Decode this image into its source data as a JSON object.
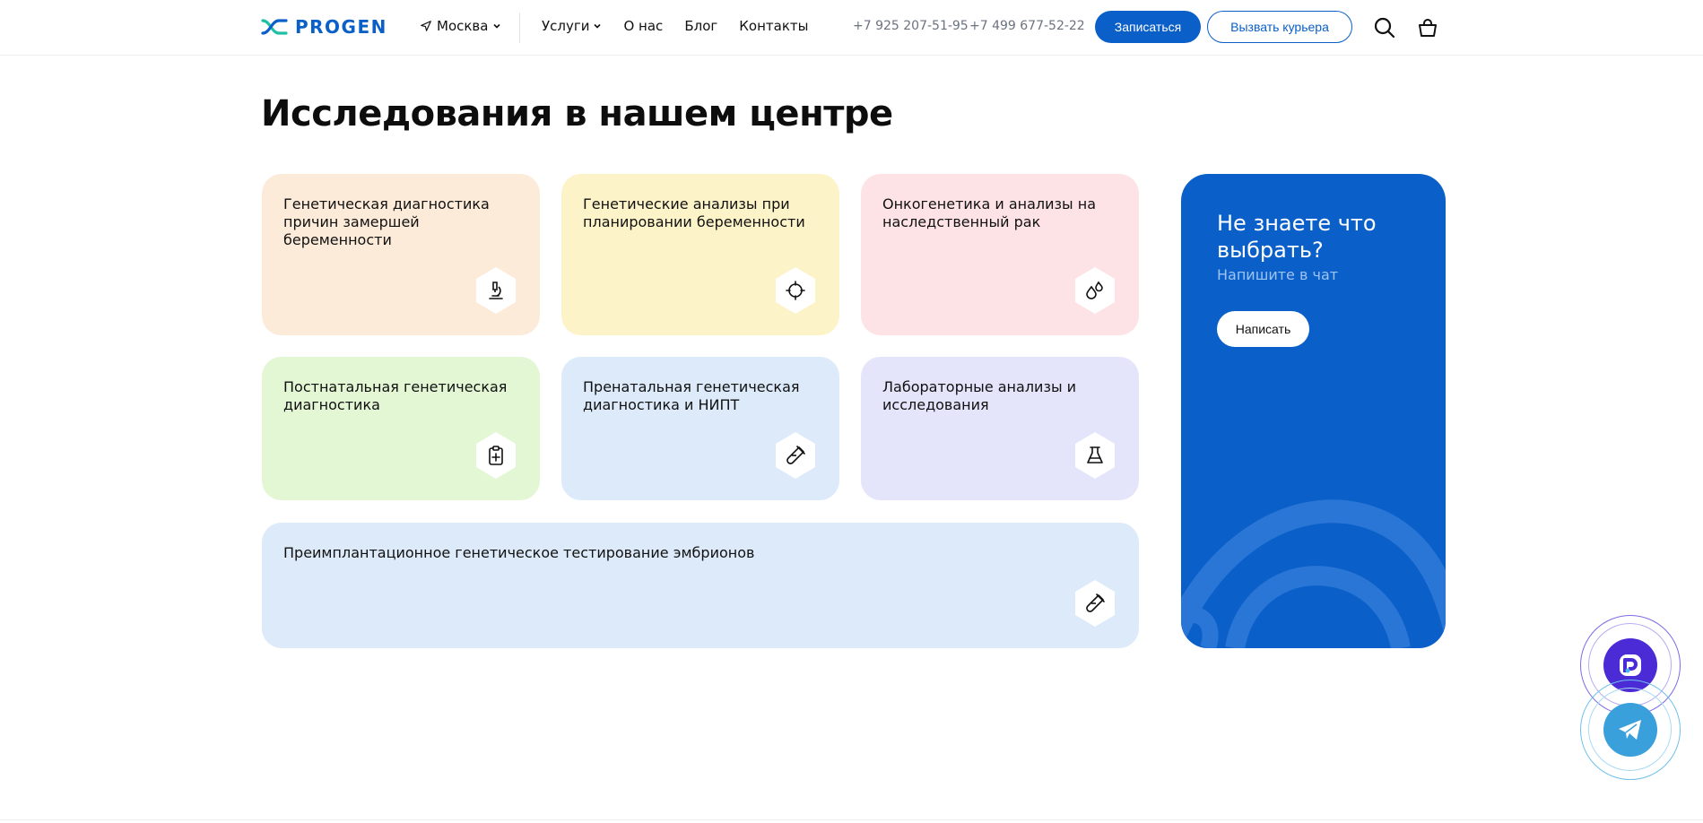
{
  "header": {
    "logo_text": "PROGEN",
    "city": "Москва",
    "nav": [
      {
        "label": "Услуги",
        "has_dropdown": true
      },
      {
        "label": "О нас",
        "has_dropdown": false
      },
      {
        "label": "Блог",
        "has_dropdown": false
      },
      {
        "label": "Контакты",
        "has_dropdown": false
      }
    ],
    "phones": [
      "+7 925 207-51-95",
      "+7 499 677-52-22"
    ],
    "signup_label": "Записаться",
    "courier_label": "Вызвать курьера",
    "icons": [
      "search-icon",
      "cart-icon"
    ]
  },
  "main": {
    "title": "Исследования в нашем центре",
    "cards": [
      {
        "title": "Генетическая диагностика причин замершей беременности",
        "color": "#fdebd9",
        "icon": "microscope-icon"
      },
      {
        "title": "Генетические анализы при планировании беременности",
        "color": "#fdf3c8",
        "icon": "crosshair-icon"
      },
      {
        "title": "Онкогенетика и анализы на наследственный рак",
        "color": "#fde3e6",
        "icon": "drops-icon"
      },
      {
        "title": "Постнатальная генетическая диагностика",
        "color": "#e3f7d4",
        "icon": "clipboard-plus-icon"
      },
      {
        "title": "Пренатальная генетическая диагностика и НИПТ",
        "color": "#dceafa",
        "icon": "test-tube-icon"
      },
      {
        "title": "Лабораторные анализы и исследования",
        "color": "#e4e4fb",
        "icon": "flask-icon"
      },
      {
        "title": "Преимплантационное генетическое тестирование эмбрионов",
        "color": "#dceafa",
        "icon": "test-tube-icon"
      }
    ],
    "promo": {
      "title": "Не знаете что выбрать?",
      "subtitle": "Напишите в чат",
      "button_label": "Написать",
      "color": "#0a5fc8"
    }
  },
  "floating": {
    "chat_color": "#4b2bd6",
    "telegram_color": "#3aa0dc",
    "icons": [
      "chat-app-icon",
      "telegram-icon"
    ]
  },
  "colors": {
    "brand": "#0a5fc8",
    "logo_accent": "#1fbfa5"
  }
}
